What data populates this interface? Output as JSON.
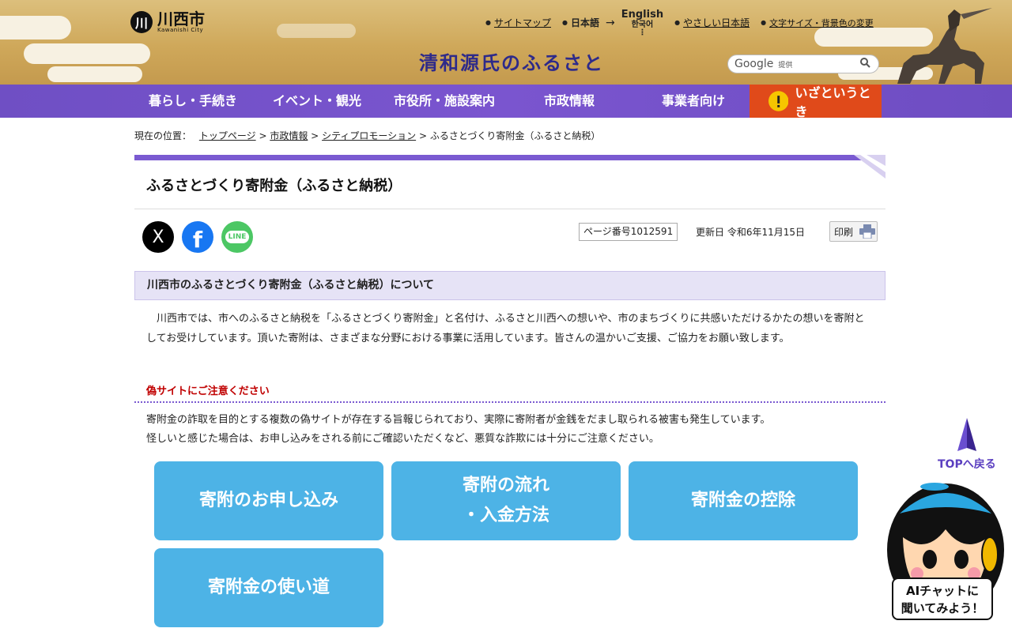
{
  "header": {
    "logo_mark": "川",
    "logo_text": "川西市",
    "logo_sub": "Kawanishi City",
    "tagline": "清和源氏のふるさと",
    "utility_links": {
      "sitemap": "サイトマップ",
      "lang_current": "日本語",
      "arrow": "→",
      "lang_english": "English",
      "lang_korean": "한국어",
      "lang_more": "⋮",
      "easy_japanese": "やさしい日本語",
      "text_size": "文字サイズ・背景色の変更"
    },
    "search": {
      "brand": "Google",
      "provided": "提供"
    }
  },
  "nav": {
    "items": [
      "暮らし・手続き",
      "イベント・観光",
      "市役所・施設案内",
      "市政情報",
      "事業者向け"
    ],
    "emergency": "いざというとき"
  },
  "breadcrumb": {
    "prefix": "現在の位置：",
    "links": [
      "トップページ",
      "市政情報",
      "シティプロモーション"
    ],
    "separator": ">",
    "current": "ふるさとづくり寄附金（ふるさと納税）"
  },
  "page": {
    "title": "ふるさとづくり寄附金（ふるさと納税）",
    "page_number": "ページ番号1012591",
    "updated": "更新日 令和6年11月15日",
    "print": "印刷",
    "sns": {
      "x": "X",
      "facebook": "f",
      "line": "LINE"
    }
  },
  "section": {
    "heading": "川西市のふるさとづくり寄附金（ふるさと納税）について",
    "intro": "　川西市では、市へのふるさと納税を「ふるさとづくり寄附金」と名付け、ふるさと川西への想いや、市のまちづくりに共感いただけるかたの想いを寄附としてお受けしています。頂いた寄附は、さまざまな分野における事業に活用しています。皆さんの温かいご支援、ご協力をお願い致します。",
    "warning_heading": "偽サイトにご注意ください",
    "warning_line1": "寄附金の詐取を目的とする複数の偽サイトが存在する旨報じられており、実際に寄附者が金銭をだまし取られる被害も発生しています。",
    "warning_line2": "怪しいと感じた場合は、お申し込みをされる前にご確認いただくなど、悪質な詐欺には十分にご注意ください。"
  },
  "buttons": {
    "apply": "寄附のお申し込み",
    "flow_line1": "寄附の流れ",
    "flow_line2": "・入金方法",
    "deduction": "寄附金の控除",
    "usage": "寄附金の使い道"
  },
  "floating": {
    "top": "TOPへ戻る",
    "chat_line1": "AIチャットに",
    "chat_line2": "聞いてみよう！"
  },
  "colors": {
    "nav": "#7a55cf",
    "emergency": "#e04a1a",
    "button": "#4db3e6",
    "warning": "#c00000"
  }
}
